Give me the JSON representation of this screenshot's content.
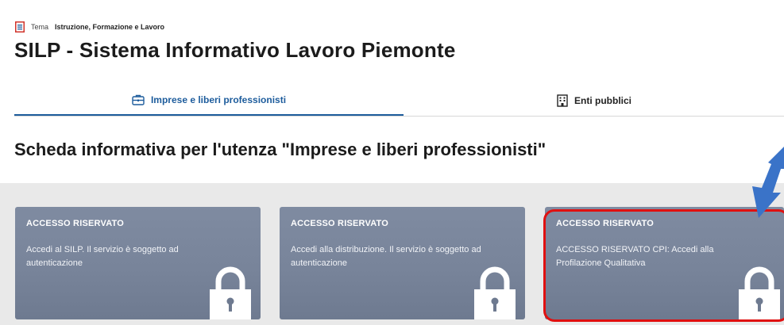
{
  "tema": {
    "key": "Tema",
    "value": "Istruzione, Formazione e Lavoro",
    "icon": "document-icon"
  },
  "page_title": "SILP - Sistema Informativo Lavoro Piemonte",
  "tabs": [
    {
      "label": "Imprese e liberi professionisti",
      "icon": "briefcase-icon",
      "active": true
    },
    {
      "label": "Enti pubblici",
      "icon": "building-icon",
      "active": false
    }
  ],
  "section_title": "Scheda informativa per l'utenza \"Imprese e liberi professionisti\"",
  "cards": [
    {
      "title": "ACCESSO RISERVATO",
      "description": "Accedi al SILP. Il servizio è soggetto ad autenticazione",
      "icon": "lock-icon"
    },
    {
      "title": "ACCESSO RISERVATO",
      "description": "Accedi alla distribuzione. Il servizio è soggetto ad autenticazione",
      "icon": "lock-icon"
    },
    {
      "title": "ACCESSO RISERVATO",
      "description": "ACCESSO RISERVATO CPI: Accedi alla Profilazione Qualitativa",
      "icon": "lock-icon"
    }
  ],
  "colors": {
    "accent": "#1d5c9c",
    "card_bg": "#7c889e",
    "area_bg": "#e9e9e9",
    "highlight": "#e01010",
    "arrow": "#3a73c8"
  }
}
